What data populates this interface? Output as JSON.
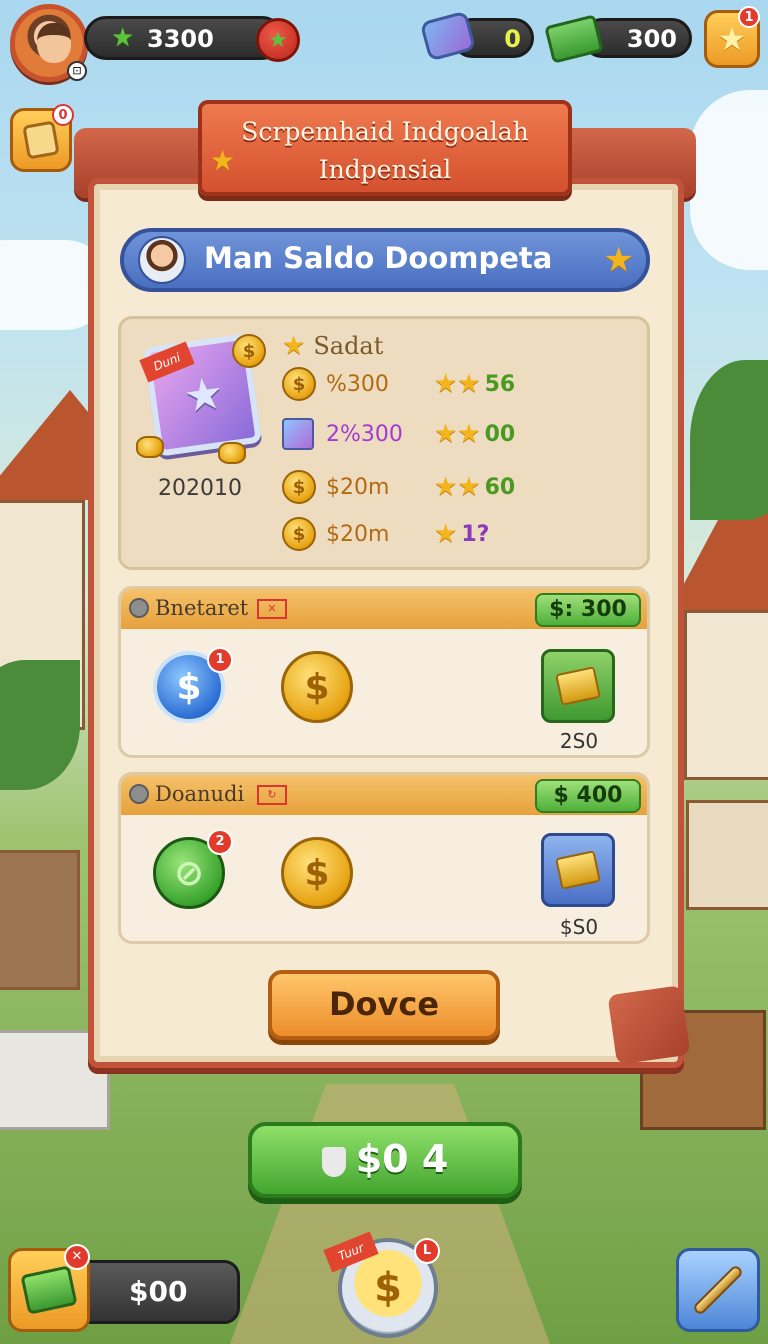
{
  "topbar": {
    "stars_value": "3300",
    "gems_value": "0",
    "cash_value": "300",
    "notif_count": "1"
  },
  "sidebar": {
    "bag_notif": "0"
  },
  "panel": {
    "title": "Scrpemhaid Indgoalah Indpensial",
    "header_label": "Man Saldo Doompeta",
    "card": {
      "tag": "Duni",
      "caption": "202010"
    },
    "stats": {
      "heading": "Sadat",
      "rows": [
        {
          "amount": "%300",
          "stars": "★★",
          "score": "56",
          "color": "#4a9a22"
        },
        {
          "amount": "2%300",
          "stars": "★★",
          "score": "00",
          "color": "#4a9a22"
        },
        {
          "amount": "$20m",
          "stars": "★★",
          "score": "60",
          "color": "#4a9a22"
        },
        {
          "amount": "$20m",
          "stars": "★",
          "score": "1?",
          "color": "#8a3ab8"
        }
      ]
    },
    "offers": [
      {
        "title": "Bnetaret",
        "tag": "✕",
        "price": "$: 300",
        "badge": "1",
        "reward_label": "2S0"
      },
      {
        "title": "Doanudi",
        "tag": "↻",
        "price": "$ 400",
        "badge": "2",
        "reward_label": "$S0"
      }
    ],
    "done_label": "Dovce"
  },
  "main_button_label": "$0 4",
  "bottom": {
    "balance": "$00",
    "bundle_badge": "✕",
    "coin_tag": "Tuur",
    "coin_badge": "L"
  },
  "icons": {
    "coin": "$"
  }
}
